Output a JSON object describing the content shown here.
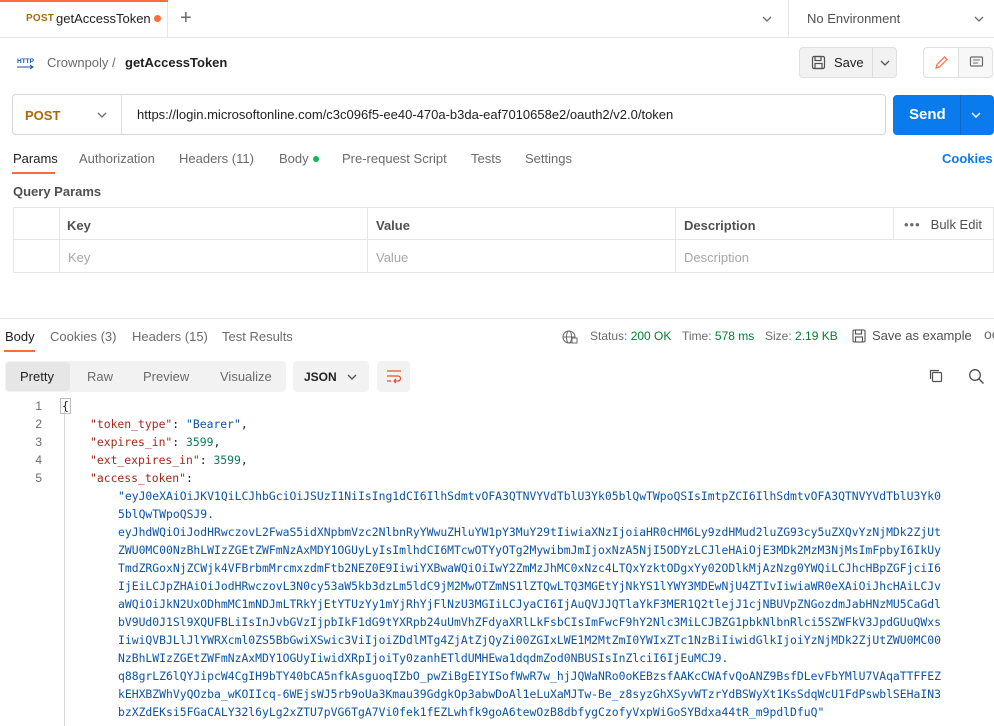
{
  "tabstrip": {
    "tab_method": "POST",
    "tab_name": "getAccessToken",
    "new_tab": "+",
    "environment": "No Environment"
  },
  "breadcrumb": {
    "icon_label": "HTTP",
    "parent": "Crownpoly",
    "separator": "/",
    "current": "getAccessToken"
  },
  "toolbar": {
    "save_label": "Save"
  },
  "request": {
    "method": "POST",
    "url": "https://login.microsoftonline.com/c3c096f5-ee40-470a-b3da-eaf7010658e2/oauth2/v2.0/token",
    "send_label": "Send"
  },
  "request_tabs": [
    {
      "label": "Params",
      "count": ""
    },
    {
      "label": "Authorization",
      "count": ""
    },
    {
      "label": "Headers",
      "count": "(11)"
    },
    {
      "label": "Body",
      "count": ""
    },
    {
      "label": "Pre-request Script",
      "count": ""
    },
    {
      "label": "Tests",
      "count": ""
    },
    {
      "label": "Settings",
      "count": ""
    }
  ],
  "cookies_link": "Cookies",
  "query_params": {
    "title": "Query Params",
    "headers": [
      "Key",
      "Value",
      "Description"
    ],
    "placeholders": [
      "Key",
      "Value",
      "Description"
    ],
    "bulk_edit": "Bulk Edit",
    "dots": "•••"
  },
  "response_tabs": [
    {
      "label": "Body",
      "count": ""
    },
    {
      "label": "Cookies",
      "count": "(3)"
    },
    {
      "label": "Headers",
      "count": "(15)"
    },
    {
      "label": "Test Results",
      "count": ""
    }
  ],
  "status": {
    "status_label": "Status:",
    "status_value": "200 OK",
    "time_label": "Time:",
    "time_value": "578 ms",
    "size_label": "Size:",
    "size_value": "2.19 KB",
    "save_example": "Save as example",
    "more": "oo"
  },
  "view_modes": [
    "Pretty",
    "Raw",
    "Preview",
    "Visualize"
  ],
  "format": "JSON",
  "code": {
    "line_numbers": [
      "1",
      "2",
      "3",
      "4",
      "5"
    ],
    "open_brace": "{",
    "token_type_key": "\"token_type\"",
    "token_type_value": "\"Bearer\"",
    "expires_in_key": "\"expires_in\"",
    "expires_in_value": "3599",
    "ext_expires_in_key": "\"ext_expires_in\"",
    "ext_expires_in_value": "3599",
    "access_token_key": "\"access_token\"",
    "access_token_lines": [
      "\"eyJ0eXAiOiJKV1QiLCJhbGciOiJSUzI1NiIsIng1dCI6IlhSdmtvOFA3QTNVYVdTblU3Yk05blQwTWpoQSIsImtpZCI6IlhSdmtvOFA3QTNVYVdTblU3Yk0",
      "5blQwTWpoQSJ9.",
      "eyJhdWQiOiJodHRwczovL2FwaS5idXNpbmVzc2NlbnRyYWwuZHluYW1pY3MuY29tIiwiaXNzIjoiaHR0cHM6Ly9zdHMud2luZG93cy5uZXQvYzNjMDk2ZjUt",
      "ZWU0MC00NzBhLWIzZGEtZWFmNzAxMDY1OGUyLyIsImlhdCI6MTcwOTYyOTg2MywibmJmIjoxNzA5NjI5ODYzLCJleHAiOjE3MDk2MzM3NjMsImFpbyI6IkUy",
      "TmdZRGoxNjZCWjk4VFBrbmMrcmxzdmFtb2NEZ0E9IiwiYXBwaWQiOiIwY2ZmMzJhMC0xNzc4LTQxYzktODgxYy02ODlkMjAzNzg0YWQiLCJhcHBpZGFjciI6",
      "IjEiLCJpZHAiOiJodHRwczovL3N0cy53aW5kb3dzLm5ldC9jM2MwOTZmNS1lZTQwLTQ3MGEtYjNkYS1lYWY3MDEwNjU4ZTIvIiwiaWR0eXAiOiJhcHAiLCJv",
      "aWQiOiJkN2UxODhmMC1mNDJmLTRkYjEtYTUzYy1mYjRhYjFlNzU3MGIiLCJyaCI6IjAuQVJJQTlaYkF3MER1Q2tlejJ1cjNBUVpZNGozdmJabHNzMU5CaGdl",
      "bV9Ud0J1Sl9XQUFBLiIsInJvbGVzIjpbIkF1dG9tYXRpb24uUmVhZFdyaXRlLkFsbCIsImFwcF9hY2Nlc3MiLCJBZG1pbkNlbnRlci5SZWFkV3JpdGUuQWxs",
      "IiwiQVBJLlJlYWRXcml0ZS5BbGwiXSwic3ViIjoiZDdlMTg4ZjAtZjQyZi00ZGIxLWE1M2MtZmI0YWIxZTc1NzBiIiwidGlkIjoiYzNjMDk2ZjUtZWU0MC00",
      "NzBhLWIzZGEtZWFmNzAxMDY1OGUyIiwidXRpIjoiTy0zanhETldUMHEwa1dqdmZod0NBUSIsInZlciI6IjEuMCJ9.",
      "q88grLZ6lQYJipcW4CgIH9bTY40bCA5nfkAsguoqIZbO_pwZiBgEIYISofWwR7w_hjJQWaNRo0oKEBzsfAAKcCWAfvQoANZ9BsfDLevFbYMlU7VAqaTTFFEZ",
      "kEHXBZWhVyQOzba_wKOIIcq-6WEjsWJ5rb9oUa3Kmau39GdgkOp3abwDoAl1eLuXaMJTw-Be_z8syzGhXSyvWTzrYdBSWyXt1KsSdqWcU1FdPswblSEHaIN3",
      "bzXZdEKsi5FGaCALY32l6yLg2xZTU7pVG6TgA7Vi0fek1fEZLwhfk9goA6tewOzB8dbfygCzofyVxpWiGoSYBdxa44tR_m9pdlDfuQ\""
    ]
  }
}
